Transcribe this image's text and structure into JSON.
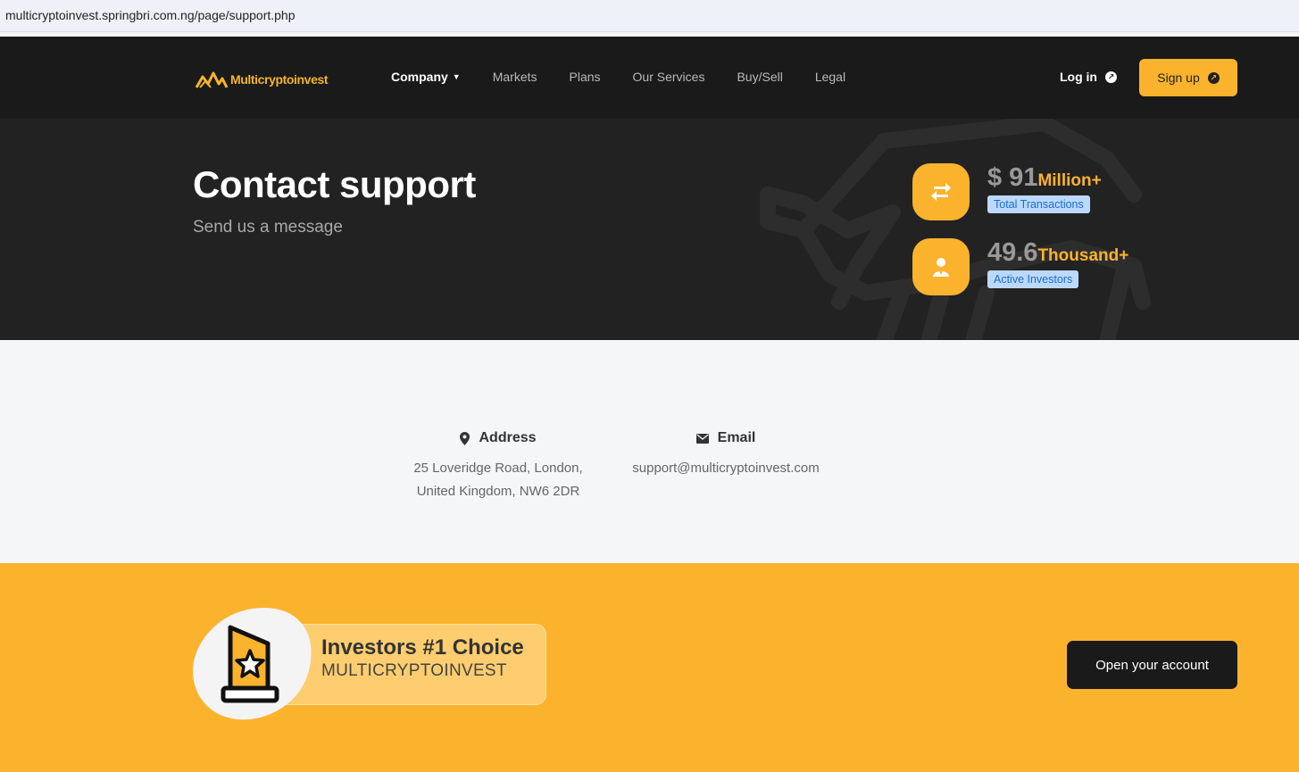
{
  "browser": {
    "url": "multicryptoinvest.springbri.com.ng/page/support.php"
  },
  "brand": {
    "name": "Multicryptoinvest",
    "color": "#fbb32d"
  },
  "nav": {
    "items": [
      {
        "label": "Company",
        "active": true,
        "dropdown": true
      },
      {
        "label": "Markets"
      },
      {
        "label": "Plans"
      },
      {
        "label": "Our Services"
      },
      {
        "label": "Buy/Sell"
      },
      {
        "label": "Legal"
      }
    ],
    "login_label": "Log in",
    "signup_label": "Sign up"
  },
  "hero": {
    "title": "Contact support",
    "subtitle": "Send us a message",
    "stats": [
      {
        "value": "$ 91",
        "unit": "Million+",
        "label": "Total Transactions",
        "icon": "exchange-arrows-icon"
      },
      {
        "value": "49.6",
        "unit": "Thousand+",
        "label": "Active Investors",
        "icon": "investor-user-icon"
      }
    ]
  },
  "contact": {
    "address": {
      "heading": "Address",
      "line1": "25 Loveridge Road, London,",
      "line2": "United Kingdom, NW6 2DR",
      "icon": "map-pin-icon"
    },
    "email": {
      "heading": "Email",
      "value": "support@multicryptoinvest.com",
      "icon": "envelope-icon"
    }
  },
  "cta": {
    "badge_title": "Investors #1 Choice",
    "badge_subtitle": "MULTICRYPTOINVEST",
    "button_label": "Open your account",
    "icon": "trophy-star-icon"
  }
}
